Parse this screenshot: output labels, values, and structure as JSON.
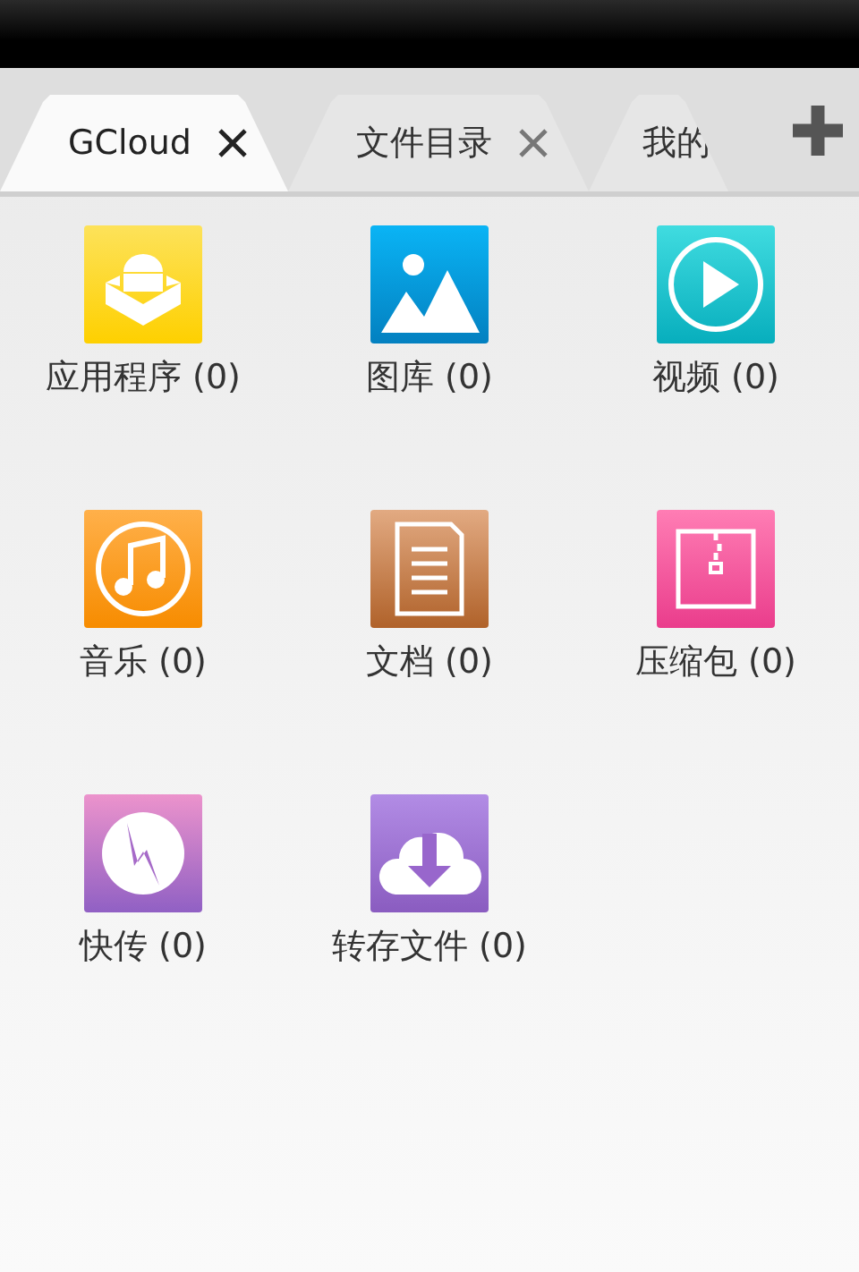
{
  "tabs": [
    {
      "label": "GCloud",
      "selected": true,
      "close": true
    },
    {
      "label": "文件目录",
      "selected": false,
      "close": true
    },
    {
      "label": "我的",
      "selected": false,
      "close": false
    }
  ],
  "categories": [
    {
      "kind": "apps",
      "label": "应用程序 (0)"
    },
    {
      "kind": "gallery",
      "label": "图库 (0)"
    },
    {
      "kind": "video",
      "label": "视频 (0)"
    },
    {
      "kind": "music",
      "label": "音乐 (0)"
    },
    {
      "kind": "docs",
      "label": "文档 (0)"
    },
    {
      "kind": "archive",
      "label": "压缩包 (0)"
    },
    {
      "kind": "transfer",
      "label": "快传 (0)"
    },
    {
      "kind": "download",
      "label": "转存文件 (0)"
    }
  ]
}
